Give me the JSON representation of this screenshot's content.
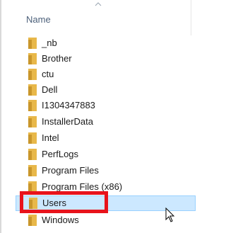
{
  "header": {
    "name_column": "Name"
  },
  "folders": [
    {
      "label": "_nb",
      "selected": false
    },
    {
      "label": "Brother",
      "selected": false
    },
    {
      "label": "ctu",
      "selected": false
    },
    {
      "label": "Dell",
      "selected": false
    },
    {
      "label": "I1304347883",
      "selected": false
    },
    {
      "label": "InstallerData",
      "selected": false
    },
    {
      "label": "Intel",
      "selected": false
    },
    {
      "label": "PerfLogs",
      "selected": false
    },
    {
      "label": "Program Files",
      "selected": false
    },
    {
      "label": "Program Files (x86)",
      "selected": false
    },
    {
      "label": "Users",
      "selected": true
    },
    {
      "label": "Windows",
      "selected": false
    }
  ],
  "colors": {
    "folder": "#e8b84a",
    "selection_bg": "#cce8ff",
    "highlight_box": "#e8131b",
    "header_text": "#4c607a"
  },
  "icons": {
    "folder": "folder-icon",
    "sort": "sort-up-icon",
    "cursor": "mouse-cursor-icon"
  }
}
